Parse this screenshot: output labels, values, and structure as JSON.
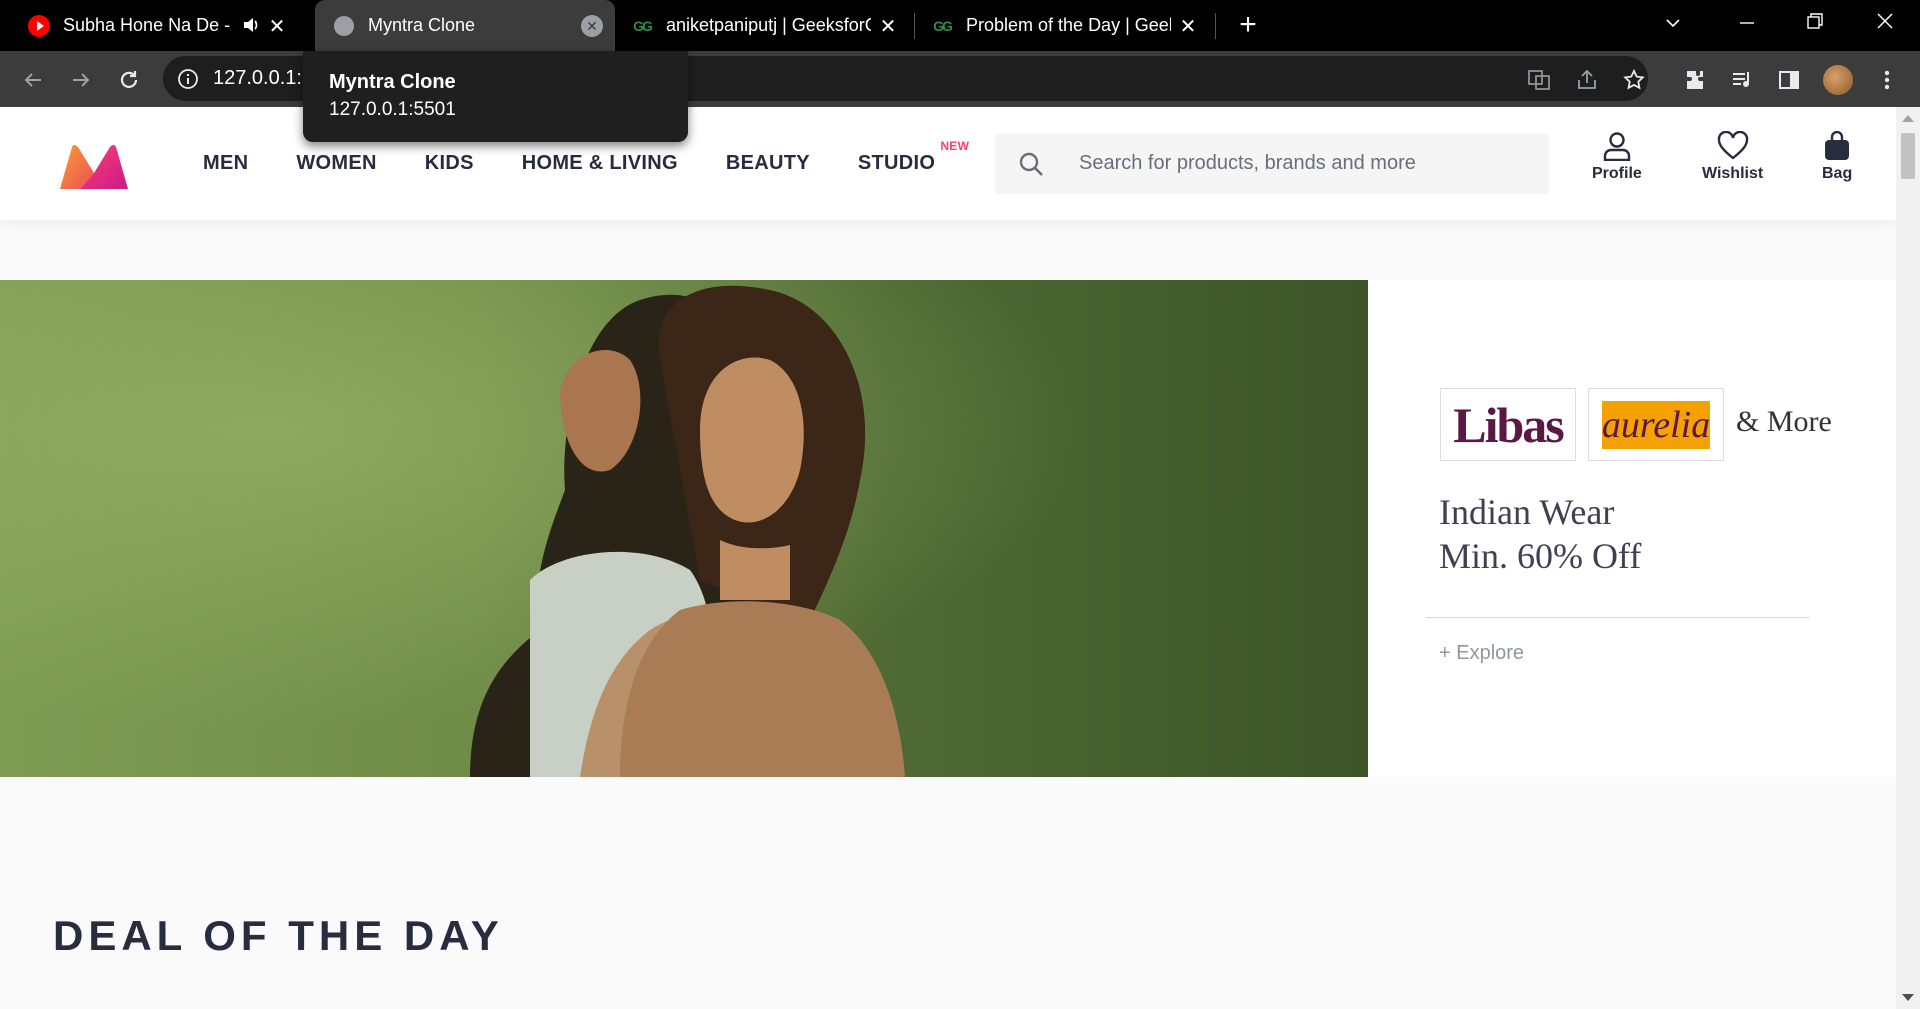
{
  "browser": {
    "tabs": [
      {
        "title": "Subha Hone Na De -",
        "favicon": "youtube-icon",
        "audio": true
      },
      {
        "title": "Myntra Clone",
        "favicon": "globe-icon",
        "active": true
      },
      {
        "title": "aniketpaniputj | GeeksforG",
        "favicon": "gfg-icon"
      },
      {
        "title": "Problem of the Day | Geek",
        "favicon": "gfg-icon"
      }
    ],
    "url": "127.0.0.1:5501",
    "tooltip": {
      "title": "Myntra Clone",
      "url": "127.0.0.1:5501"
    }
  },
  "header": {
    "nav": [
      "MEN",
      "WOMEN",
      "KIDS",
      "HOME & LIVING",
      "BEAUTY",
      "STUDIO"
    ],
    "nav_badge": "NEW",
    "search_placeholder": "Search for products, brands and more",
    "actions": {
      "profile": "Profile",
      "wishlist": "Wishlist",
      "bag": "Bag"
    }
  },
  "banner": {
    "brand1": "Libas",
    "brand2": "aurelia",
    "and_more": "& More",
    "title_line1": "Indian Wear",
    "title_line2": "Min. 60% Off",
    "explore": "+ Explore"
  },
  "section": {
    "title": "DEAL OF THE DAY"
  },
  "colors": {
    "brand": "#ff3f6c",
    "text": "#282c3f",
    "chrome_bg": "#000000",
    "toolbar_bg": "#3c3c3c"
  }
}
